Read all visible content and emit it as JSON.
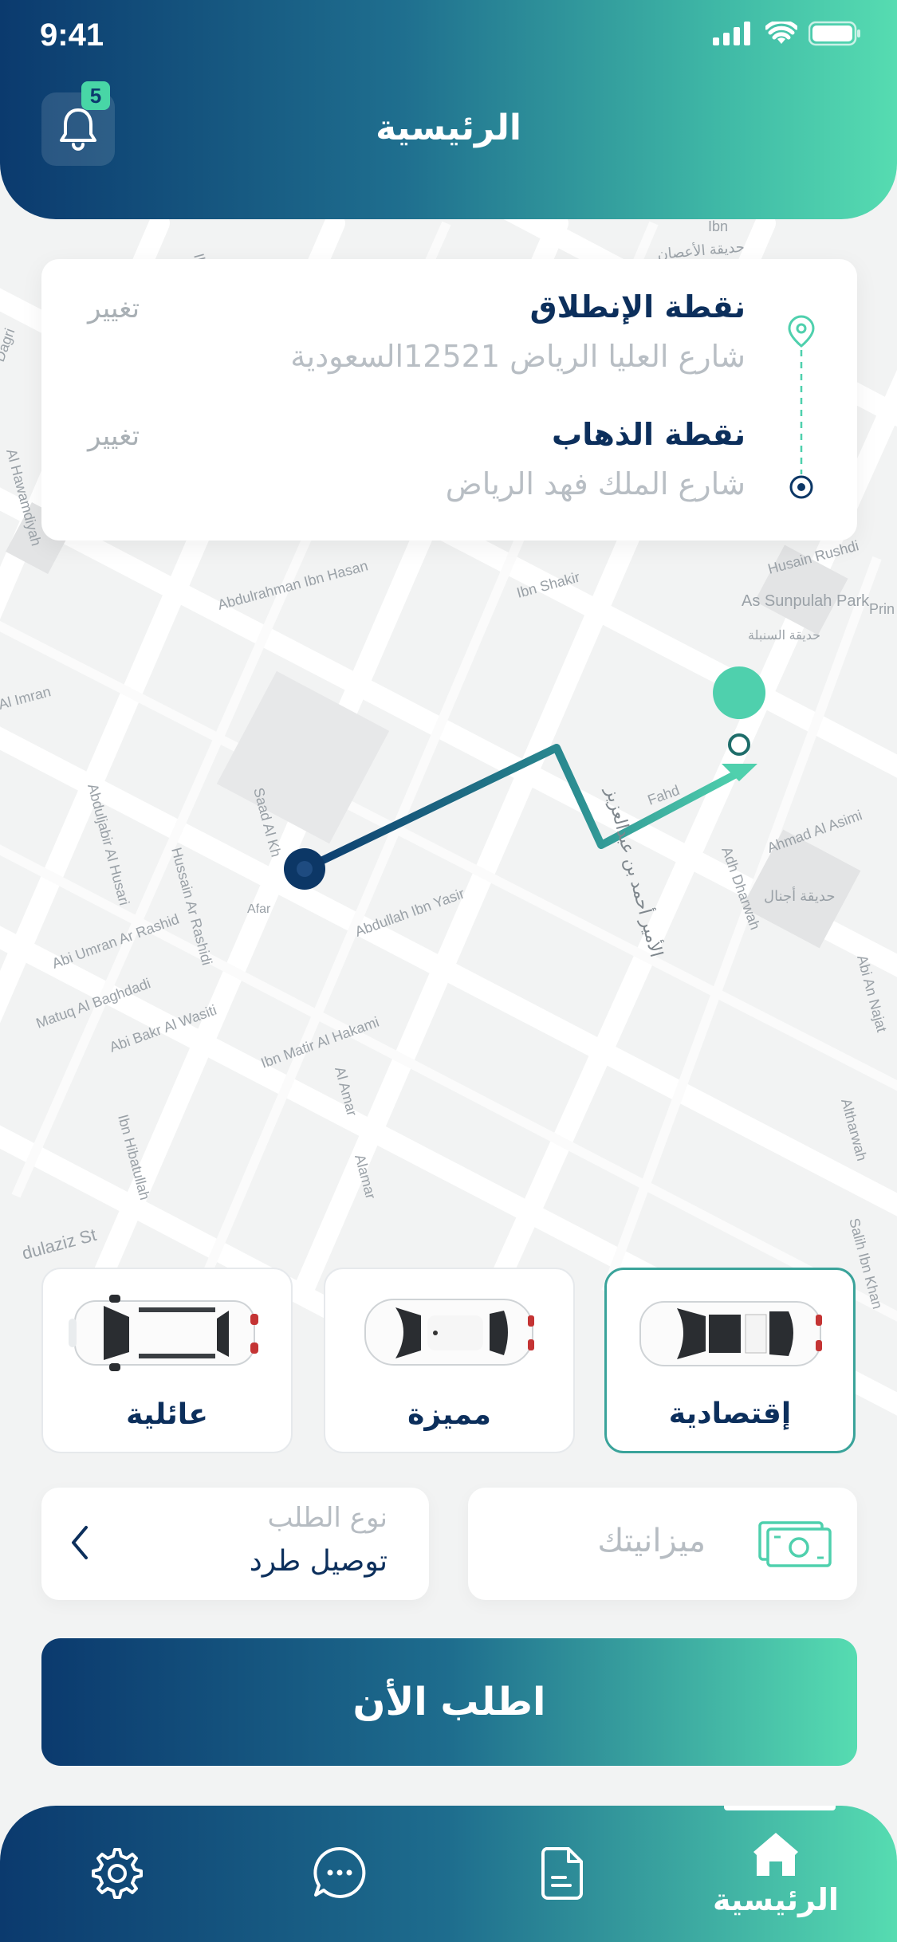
{
  "status_bar": {
    "time": "9:41"
  },
  "header": {
    "title": "الرئيسية",
    "notification_count": "5"
  },
  "location_card": {
    "pickup_title": "نقطة الإنطلاق",
    "pickup_address": "شارع العليا الرياض 12521السعودية",
    "dropoff_title": "نقطة الذهاب",
    "dropoff_address": "شارع الملك فهد الرياض",
    "change_label": "تغيير"
  },
  "vehicles": [
    {
      "name": "عائلية",
      "selected": false
    },
    {
      "name": "مميزة",
      "selected": false
    },
    {
      "name": "إقتصادية",
      "selected": true
    }
  ],
  "request_type": {
    "label": "نوع الطلب",
    "value": "توصيل طرد"
  },
  "budget": {
    "placeholder": "ميزانيتك"
  },
  "order_button": {
    "label": "اطلب الأن"
  },
  "bottom_nav": {
    "home_label": "الرئيسية"
  },
  "map_labels": [
    "Ibn M",
    "حديقة الأعصان",
    "Ibn",
    "Dagri",
    "Al Hawamdiyah",
    "Abdulrahman Ibn Hasan",
    "Ibn Shakir",
    "Husain Rushdi",
    "As Sunpulah Park",
    "حديقة السنبلة",
    "Prin",
    "Al Imran",
    "Saad Al Kh",
    "Abduljabir Al Husari",
    "Hussain Ar Rashidi",
    "Abi Umran Ar Rashid",
    "Abdullah Ibn Yasir",
    "Matuq Al Baghdadi",
    "Abi Bakr Al Wasiti",
    "Ibn Matir Al Hakami",
    "Adh Dharwah",
    "Ahmad Al Asimi",
    "حديقة أجنال",
    "Abi An Najat",
    "Al Amar",
    "Ibn Hibatullah",
    "dulaziz St",
    "Alamar",
    "Altharwah",
    "Salih Ibn Khan",
    "Afar",
    "الأمير أحمد بن عبدالعزيز",
    "Fahd"
  ]
}
